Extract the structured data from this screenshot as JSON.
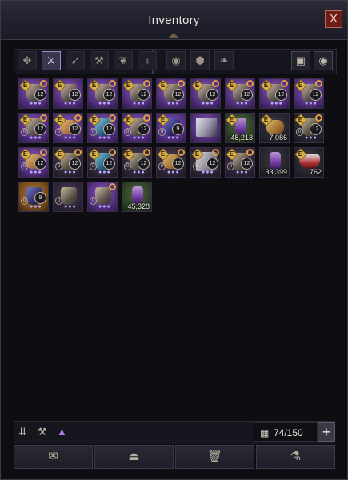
{
  "window": {
    "title": "Inventory",
    "close_label": "X"
  },
  "tabs": [
    {
      "icon": "all-items-icon",
      "glyph": "✥",
      "active": false
    },
    {
      "icon": "equipment-icon",
      "glyph": "⚔",
      "active": true
    },
    {
      "icon": "weapon-icon",
      "glyph": "➹",
      "active": false
    },
    {
      "icon": "anvil-icon",
      "glyph": "⚒",
      "active": false
    },
    {
      "icon": "feather-icon",
      "glyph": "❦",
      "active": false
    },
    {
      "icon": "pouch-icon",
      "glyph": "♁",
      "active": false
    },
    {
      "icon": "orb-icon",
      "glyph": "◉",
      "active": false
    },
    {
      "icon": "ore-icon",
      "glyph": "⬢",
      "active": false
    },
    {
      "icon": "wings-icon",
      "glyph": "❧",
      "active": false
    }
  ],
  "right_buttons": [
    {
      "icon": "layout-icon",
      "glyph": "▣"
    },
    {
      "icon": "eye-settings-icon",
      "glyph": "◉"
    }
  ],
  "slots": [
    {
      "row": 0,
      "col": 0,
      "bg": "epic",
      "art": "",
      "e": true,
      "lock": true,
      "lvl": "12",
      "dots": "●●●"
    },
    {
      "row": 0,
      "col": 1,
      "bg": "epic",
      "art": "",
      "e": true,
      "lock": false,
      "lvl": "12",
      "dots": "●●●"
    },
    {
      "row": 0,
      "col": 2,
      "bg": "epic",
      "art": "",
      "e": true,
      "lock": true,
      "lvl": "12",
      "dots": "●●●"
    },
    {
      "row": 0,
      "col": 3,
      "bg": "epic",
      "art": "",
      "e": true,
      "lock": true,
      "lvl": "12",
      "dots": "●●●"
    },
    {
      "row": 0,
      "col": 4,
      "bg": "epic",
      "art": "",
      "e": true,
      "lock": true,
      "lvl": "12",
      "dots": "●●●"
    },
    {
      "row": 0,
      "col": 5,
      "bg": "epic",
      "art": "",
      "e": true,
      "lock": true,
      "lvl": "12",
      "dots": "●●●"
    },
    {
      "row": 0,
      "col": 6,
      "bg": "epic",
      "art": "",
      "e": true,
      "lock": true,
      "lvl": "12",
      "dots": "●●●"
    },
    {
      "row": 0,
      "col": 7,
      "bg": "epic",
      "art": "",
      "e": true,
      "lock": true,
      "lvl": "12",
      "dots": "●●●"
    },
    {
      "row": 0,
      "col": 8,
      "bg": "epic",
      "art": "",
      "e": true,
      "lock": true,
      "lvl": "12",
      "dots": "●●●"
    },
    {
      "row": 1,
      "col": 0,
      "bg": "epic",
      "art": "",
      "e": true,
      "lock": true,
      "lvl": "12",
      "zero": "0",
      "dots": "●●●"
    },
    {
      "row": 1,
      "col": 1,
      "bg": "epic",
      "art": "ore",
      "e": true,
      "lock": true,
      "lvl": "12",
      "zero": "0",
      "dots": "●●●"
    },
    {
      "row": 1,
      "col": 2,
      "bg": "epic",
      "art": "blue",
      "e": true,
      "lock": true,
      "lvl": "12",
      "zero": "0",
      "dots": "●●●"
    },
    {
      "row": 1,
      "col": 3,
      "bg": "epic",
      "art": "",
      "e": true,
      "lock": true,
      "lvl": "12",
      "zero": "0",
      "dots": "●●●"
    },
    {
      "row": 1,
      "col": 4,
      "bg": "epic",
      "art": "hood",
      "e": true,
      "lock": false,
      "lvl": "9",
      "zero": "0",
      "dots": "●●●"
    },
    {
      "row": 1,
      "col": 5,
      "bg": "epic",
      "art": "wing",
      "e": false,
      "lock": false,
      "lvl": "",
      "dots": ""
    },
    {
      "row": 1,
      "col": 6,
      "bg": "green",
      "art": "potion",
      "e": true,
      "lock": false,
      "lvl": "",
      "qty": "48,213"
    },
    {
      "row": 1,
      "col": 7,
      "bg": "dark",
      "art": "ore",
      "e": true,
      "lock": false,
      "lvl": "",
      "qty": "7,086"
    },
    {
      "row": 1,
      "col": 8,
      "bg": "dark",
      "art": "",
      "e": true,
      "lock": true,
      "lvl": "12",
      "zero": "0",
      "dots": "●●●"
    },
    {
      "row": 2,
      "col": 0,
      "bg": "epic",
      "art": "ore",
      "e": true,
      "lock": true,
      "lvl": "12",
      "zero": "0",
      "dots": "●●●"
    },
    {
      "row": 2,
      "col": 1,
      "bg": "fade",
      "art": "",
      "e": true,
      "lock": true,
      "lvl": "12",
      "zero": "0",
      "dots": "●●●"
    },
    {
      "row": 2,
      "col": 2,
      "bg": "fade",
      "art": "blue",
      "e": true,
      "lock": true,
      "lvl": "12",
      "zero": "0",
      "dots": "●●●"
    },
    {
      "row": 2,
      "col": 3,
      "bg": "fade",
      "art": "",
      "e": true,
      "lock": true,
      "lvl": "12",
      "zero": "0",
      "dots": "●●●"
    },
    {
      "row": 2,
      "col": 4,
      "bg": "fade",
      "art": "ore",
      "e": true,
      "lock": true,
      "lvl": "12",
      "zero": "0",
      "dots": "●●●"
    },
    {
      "row": 2,
      "col": 5,
      "bg": "fade",
      "art": "wing",
      "e": true,
      "lock": true,
      "lvl": "12",
      "zero": "0",
      "dots": "●●●"
    },
    {
      "row": 2,
      "col": 6,
      "bg": "fade",
      "art": "",
      "e": true,
      "lock": true,
      "lvl": "12",
      "zero": "0",
      "dots": "●●●"
    },
    {
      "row": 2,
      "col": 7,
      "bg": "dark",
      "art": "potion",
      "e": false,
      "lock": false,
      "lvl": "",
      "qty": "33,399"
    },
    {
      "row": 2,
      "col": 8,
      "bg": "dark",
      "art": "shield",
      "e": true,
      "lock": false,
      "lvl": "",
      "qty": "762"
    },
    {
      "row": 3,
      "col": 0,
      "bg": "orange",
      "art": "hood",
      "e": false,
      "lock": false,
      "lvl": "9",
      "zero": "0",
      "dots": "●●●"
    },
    {
      "row": 3,
      "col": 1,
      "bg": "fade",
      "art": "",
      "e": false,
      "lock": false,
      "lvl": "",
      "zero": "0",
      "dots": "●●●"
    },
    {
      "row": 3,
      "col": 2,
      "bg": "epic",
      "art": "",
      "e": false,
      "lock": true,
      "lvl": "",
      "zero": "0",
      "dots": "●●●"
    },
    {
      "row": 3,
      "col": 3,
      "bg": "green",
      "art": "potion",
      "e": false,
      "lock": false,
      "lvl": "",
      "qty": "45,328"
    }
  ],
  "bottom": {
    "sort_icons": [
      {
        "icon": "sort-icon",
        "glyph": "⇊"
      },
      {
        "icon": "anvil-icon",
        "glyph": "⚒"
      },
      {
        "icon": "grade-filter-icon",
        "glyph": "▲"
      }
    ],
    "count_icon": "▦",
    "capacity": "74/150",
    "expand_label": "+"
  },
  "actions": [
    {
      "icon": "scroll-icon",
      "glyph": "✉"
    },
    {
      "icon": "upgrade-icon",
      "glyph": "⏏"
    },
    {
      "icon": "trash-icon",
      "glyph": "🗑"
    },
    {
      "icon": "flask-icon",
      "glyph": "⚗"
    }
  ]
}
